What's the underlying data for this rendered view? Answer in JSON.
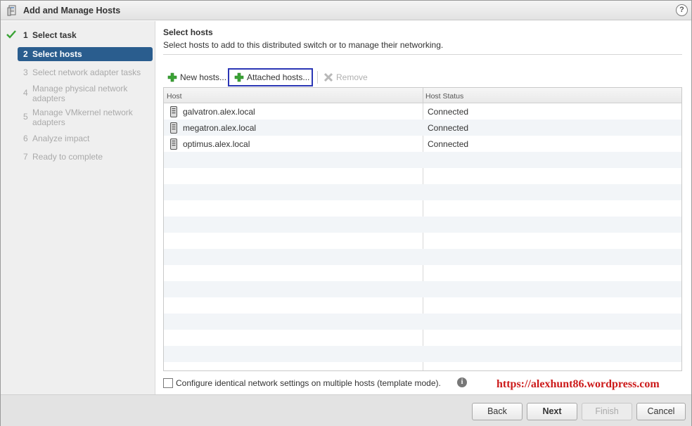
{
  "window": {
    "title": "Add and Manage Hosts",
    "help": "?"
  },
  "nav": {
    "steps": [
      {
        "num": "1",
        "label": "Select task",
        "state": "done"
      },
      {
        "num": "2",
        "label": "Select hosts",
        "state": "active"
      },
      {
        "num": "3",
        "label": "Select network adapter tasks",
        "state": "pending"
      },
      {
        "num": "4",
        "label": "Manage physical network adapters",
        "state": "pending"
      },
      {
        "num": "5",
        "label": "Manage VMkernel network adapters",
        "state": "pending"
      },
      {
        "num": "6",
        "label": "Analyze impact",
        "state": "pending"
      },
      {
        "num": "7",
        "label": "Ready to complete",
        "state": "pending"
      }
    ]
  },
  "page": {
    "title": "Select hosts",
    "description": "Select hosts to add to this distributed switch or to manage their networking."
  },
  "toolbar": {
    "new_hosts": "New hosts...",
    "attached_hosts": "Attached hosts...",
    "remove": "Remove"
  },
  "grid": {
    "columns": {
      "host": "Host",
      "status": "Host Status"
    },
    "rows": [
      {
        "host": "galvatron.alex.local",
        "status": "Connected"
      },
      {
        "host": "megatron.alex.local",
        "status": "Connected"
      },
      {
        "host": "optimus.alex.local",
        "status": "Connected"
      }
    ]
  },
  "template_mode": {
    "label": "Configure identical network settings on multiple hosts (template mode).",
    "checked": false
  },
  "watermark": "https://alexhunt86.wordpress.com",
  "footer": {
    "back": "Back",
    "next": "Next",
    "finish": "Finish",
    "cancel": "Cancel"
  },
  "colors": {
    "active_step": "#2a5d8e",
    "highlight_box": "#2b36b5",
    "watermark": "#cc1a1a",
    "add_icon": "#3aa335"
  }
}
